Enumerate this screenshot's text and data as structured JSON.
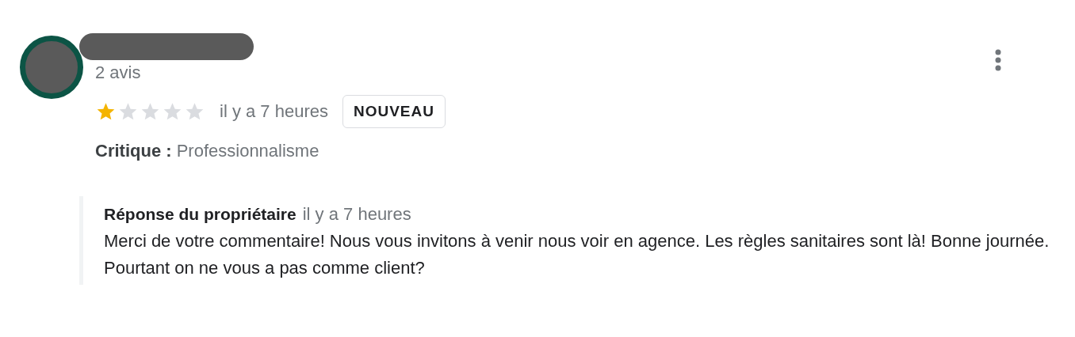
{
  "review": {
    "reviewer_count": "2 avis",
    "stars": 1,
    "time": "il y a 7 heures",
    "badge": "NOUVEAU",
    "critique": "**Critique :** Professionnalisme",
    "reply": {
      "title": "Réponse du propriétaire",
      "time": "il y a 7 heures",
      "text": "Merci de votre commentaire! Nous vous invitons à venir nous voir en agence. Les règles sanitaires sont là! Bonne journée. Pourtant on ne vous a pas comme client?"
    }
  }
}
